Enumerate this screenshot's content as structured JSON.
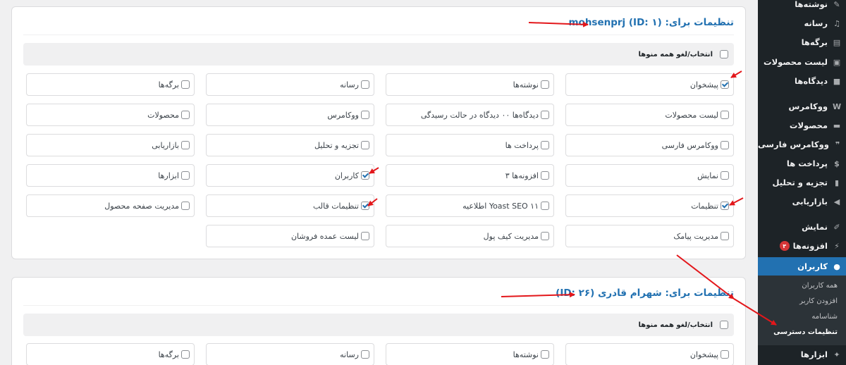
{
  "panels": [
    {
      "title": "تنظیمات برای: mohsenprj (ID: ۱)",
      "select_all": "انتخاب/لغو همه منوها",
      "options": [
        {
          "label": "پیشخوان",
          "checked": true
        },
        {
          "label": "نوشته‌ها",
          "checked": false
        },
        {
          "label": "رسانه",
          "checked": false
        },
        {
          "label": "برگه‌ها",
          "checked": false
        },
        {
          "label": "لیست محصولات",
          "checked": false
        },
        {
          "label": "دیدگاه‌ها ۰۰ دیدگاه در حالت رسیدگی",
          "checked": false
        },
        {
          "label": "ووکامرس",
          "checked": false
        },
        {
          "label": "محصولات",
          "checked": false
        },
        {
          "label": "ووکامرس فارسی",
          "checked": false
        },
        {
          "label": "پرداخت ها",
          "checked": false
        },
        {
          "label": "تجزیه و تحلیل",
          "checked": false
        },
        {
          "label": "بازاریابی",
          "checked": false
        },
        {
          "label": "نمایش",
          "checked": false
        },
        {
          "label": "افزونه‌ها ۳",
          "checked": false
        },
        {
          "label": "کاربران",
          "checked": true
        },
        {
          "label": "ابزارها",
          "checked": false
        },
        {
          "label": "تنظیمات",
          "checked": true
        },
        {
          "label": "Yoast SEO ۱۱ اطلاعیه",
          "checked": false
        },
        {
          "label": "تنظیمات قالب",
          "checked": true
        },
        {
          "label": "مدیریت صفحه محصول",
          "checked": false
        },
        {
          "label": "مدیریت پیامک",
          "checked": false
        },
        {
          "label": "مدیریت کیف پول",
          "checked": false
        },
        {
          "label": "لیست عمده فروشان",
          "checked": false
        }
      ]
    },
    {
      "title": "تنظیمات برای: شهرام قادری (ID: ۲۶)",
      "select_all": "انتخاب/لغو همه منوها",
      "options": [
        {
          "label": "پیشخوان",
          "checked": false
        },
        {
          "label": "نوشته‌ها",
          "checked": false
        },
        {
          "label": "رسانه",
          "checked": false
        },
        {
          "label": "برگه‌ها",
          "checked": false
        }
      ]
    }
  ],
  "sidebar": {
    "items": [
      {
        "label": "نوشته‌ها",
        "icon": "pin-icon",
        "glyph": "✎"
      },
      {
        "label": "رسانه",
        "icon": "media-icon",
        "glyph": "♫"
      },
      {
        "label": "برگه‌ها",
        "icon": "page-icon",
        "glyph": "▤"
      },
      {
        "label": "لیست محصولات",
        "icon": "lock-icon",
        "glyph": "▣"
      },
      {
        "label": "دیدگاه‌ها",
        "icon": "comment-icon",
        "glyph": "■"
      },
      {
        "label": "ووکامرس",
        "icon": "woo-icon",
        "glyph": "W"
      },
      {
        "label": "محصولات",
        "icon": "archive-icon",
        "glyph": "▬"
      },
      {
        "label": "ووکامرس فارسی",
        "icon": "quote-icon",
        "glyph": "❞"
      },
      {
        "label": "پرداخت ها",
        "icon": "payment-icon",
        "glyph": "$"
      },
      {
        "label": "تجزیه و تحلیل",
        "icon": "chart-icon",
        "glyph": "▮"
      },
      {
        "label": "بازاریابی",
        "icon": "megaphone-icon",
        "glyph": "◀"
      },
      {
        "label": "نمایش",
        "icon": "brush-icon",
        "glyph": "✐"
      },
      {
        "label": "افزونه‌ها",
        "icon": "plugin-icon",
        "glyph": "⚡",
        "badge": "۳"
      },
      {
        "label": "کاربران",
        "icon": "user-icon",
        "glyph": "●",
        "active": true
      },
      {
        "label": "ابزارها",
        "icon": "wrench-icon",
        "glyph": "✦"
      }
    ],
    "submenu": [
      {
        "label": "همه کاربران"
      },
      {
        "label": "افزودن کاربر"
      },
      {
        "label": "شناسامه"
      },
      {
        "label": "تنظیمات دسترسی",
        "current": true
      }
    ]
  },
  "colors": {
    "accent": "#2271b1",
    "sidebar_bg": "#1d2327",
    "annotation_red": "#e3171b"
  }
}
